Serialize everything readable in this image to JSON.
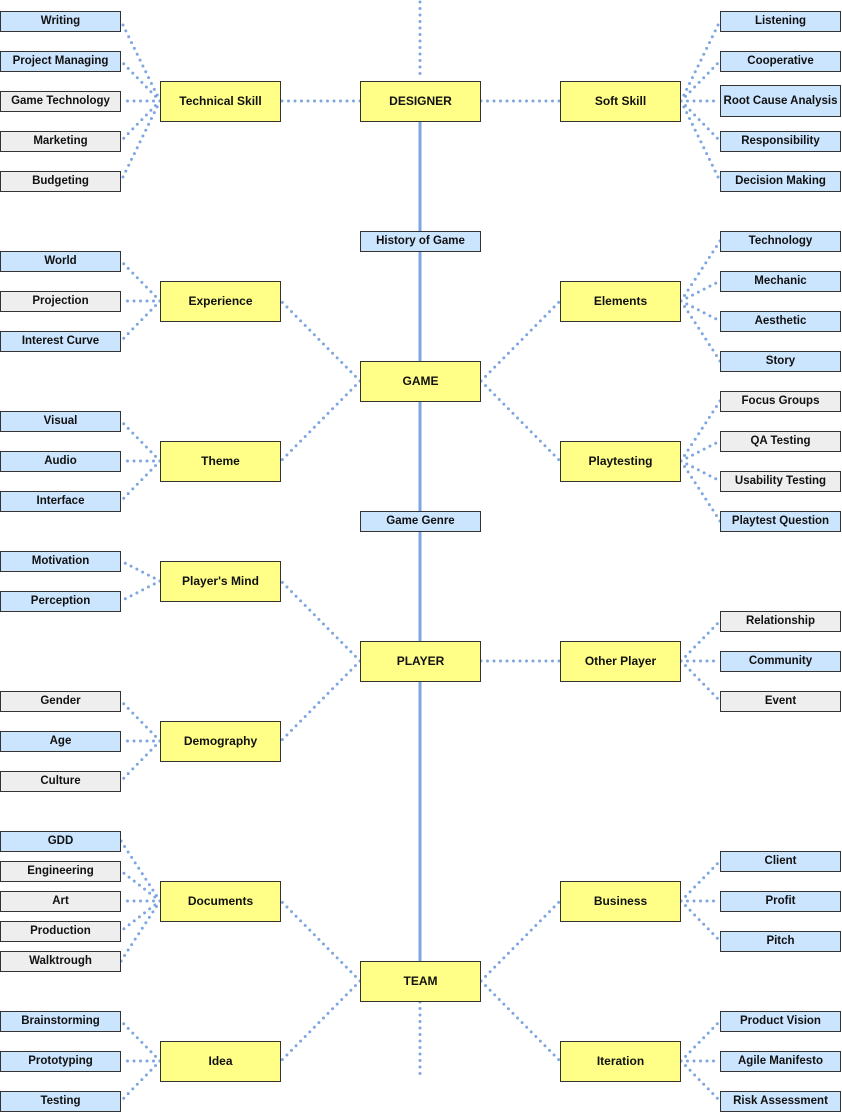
{
  "diagram": {
    "colors": {
      "category_fill": "#ffff88",
      "leaf_blue_fill": "#cce5ff",
      "leaf_gray_fill": "#eeeeee",
      "border": "#333333",
      "connector": "#7ea6e0"
    },
    "spine": [
      {
        "id": "designer",
        "label": "DESIGNER"
      },
      {
        "id": "history",
        "label": "History of Game"
      },
      {
        "id": "game",
        "label": "GAME"
      },
      {
        "id": "genre",
        "label": "Game Genre"
      },
      {
        "id": "player",
        "label": "PLAYER"
      },
      {
        "id": "team",
        "label": "TEAM"
      }
    ],
    "categories": [
      {
        "id": "technical-skill",
        "label": "Technical Skill",
        "parent": "designer",
        "side": "left",
        "children": [
          {
            "label": "Writing",
            "style": "blue"
          },
          {
            "label": "Project Managing",
            "style": "blue"
          },
          {
            "label": "Game Technology",
            "style": "gray"
          },
          {
            "label": "Marketing",
            "style": "gray"
          },
          {
            "label": "Budgeting",
            "style": "gray"
          }
        ]
      },
      {
        "id": "soft-skill",
        "label": "Soft Skill",
        "parent": "designer",
        "side": "right",
        "children": [
          {
            "label": "Listening",
            "style": "blue"
          },
          {
            "label": "Cooperative",
            "style": "blue"
          },
          {
            "label": "Root Cause Analysis",
            "style": "blue"
          },
          {
            "label": "Responsibility",
            "style": "blue"
          },
          {
            "label": "Decision Making",
            "style": "blue"
          }
        ]
      },
      {
        "id": "experience",
        "label": "Experience",
        "parent": "game",
        "side": "left",
        "children": [
          {
            "label": "World",
            "style": "blue"
          },
          {
            "label": "Projection",
            "style": "gray"
          },
          {
            "label": "Interest Curve",
            "style": "blue"
          }
        ]
      },
      {
        "id": "theme",
        "label": "Theme",
        "parent": "game",
        "side": "left",
        "children": [
          {
            "label": "Visual",
            "style": "blue"
          },
          {
            "label": "Audio",
            "style": "blue"
          },
          {
            "label": "Interface",
            "style": "blue"
          }
        ]
      },
      {
        "id": "elements",
        "label": "Elements",
        "parent": "game",
        "side": "right",
        "children": [
          {
            "label": "Technology",
            "style": "blue"
          },
          {
            "label": "Mechanic",
            "style": "blue"
          },
          {
            "label": "Aesthetic",
            "style": "blue"
          },
          {
            "label": "Story",
            "style": "blue"
          }
        ]
      },
      {
        "id": "playtesting",
        "label": "Playtesting",
        "parent": "game",
        "side": "right",
        "children": [
          {
            "label": "Focus Groups",
            "style": "gray"
          },
          {
            "label": "QA Testing",
            "style": "gray"
          },
          {
            "label": "Usability Testing",
            "style": "gray"
          },
          {
            "label": "Playtest Question",
            "style": "blue"
          }
        ]
      },
      {
        "id": "players-mind",
        "label": "Player's Mind",
        "parent": "player",
        "side": "left",
        "children": [
          {
            "label": "Motivation",
            "style": "blue"
          },
          {
            "label": "Perception",
            "style": "blue"
          }
        ]
      },
      {
        "id": "demography",
        "label": "Demography",
        "parent": "player",
        "side": "left",
        "children": [
          {
            "label": "Gender",
            "style": "gray"
          },
          {
            "label": "Age",
            "style": "blue"
          },
          {
            "label": "Culture",
            "style": "gray"
          }
        ]
      },
      {
        "id": "other-player",
        "label": "Other Player",
        "parent": "player",
        "side": "right",
        "children": [
          {
            "label": "Relationship",
            "style": "gray"
          },
          {
            "label": "Community",
            "style": "blue"
          },
          {
            "label": "Event",
            "style": "gray"
          }
        ]
      },
      {
        "id": "documents",
        "label": "Documents",
        "parent": "team",
        "side": "left",
        "children": [
          {
            "label": "GDD",
            "style": "blue"
          },
          {
            "label": "Engineering",
            "style": "gray"
          },
          {
            "label": "Art",
            "style": "gray"
          },
          {
            "label": "Production",
            "style": "gray"
          },
          {
            "label": "Walktrough",
            "style": "gray"
          }
        ]
      },
      {
        "id": "idea",
        "label": "Idea",
        "parent": "team",
        "side": "left",
        "children": [
          {
            "label": "Brainstorming",
            "style": "blue"
          },
          {
            "label": "Prototyping",
            "style": "blue"
          },
          {
            "label": "Testing",
            "style": "blue"
          }
        ]
      },
      {
        "id": "business",
        "label": "Business",
        "parent": "team",
        "side": "right",
        "children": [
          {
            "label": "Client",
            "style": "blue"
          },
          {
            "label": "Profit",
            "style": "blue"
          },
          {
            "label": "Pitch",
            "style": "blue"
          }
        ]
      },
      {
        "id": "iteration",
        "label": "Iteration",
        "parent": "team",
        "side": "right",
        "children": [
          {
            "label": "Product Vision",
            "style": "blue"
          },
          {
            "label": "Agile Manifesto",
            "style": "blue"
          },
          {
            "label": "Risk Assessment",
            "style": "blue"
          }
        ]
      }
    ]
  }
}
